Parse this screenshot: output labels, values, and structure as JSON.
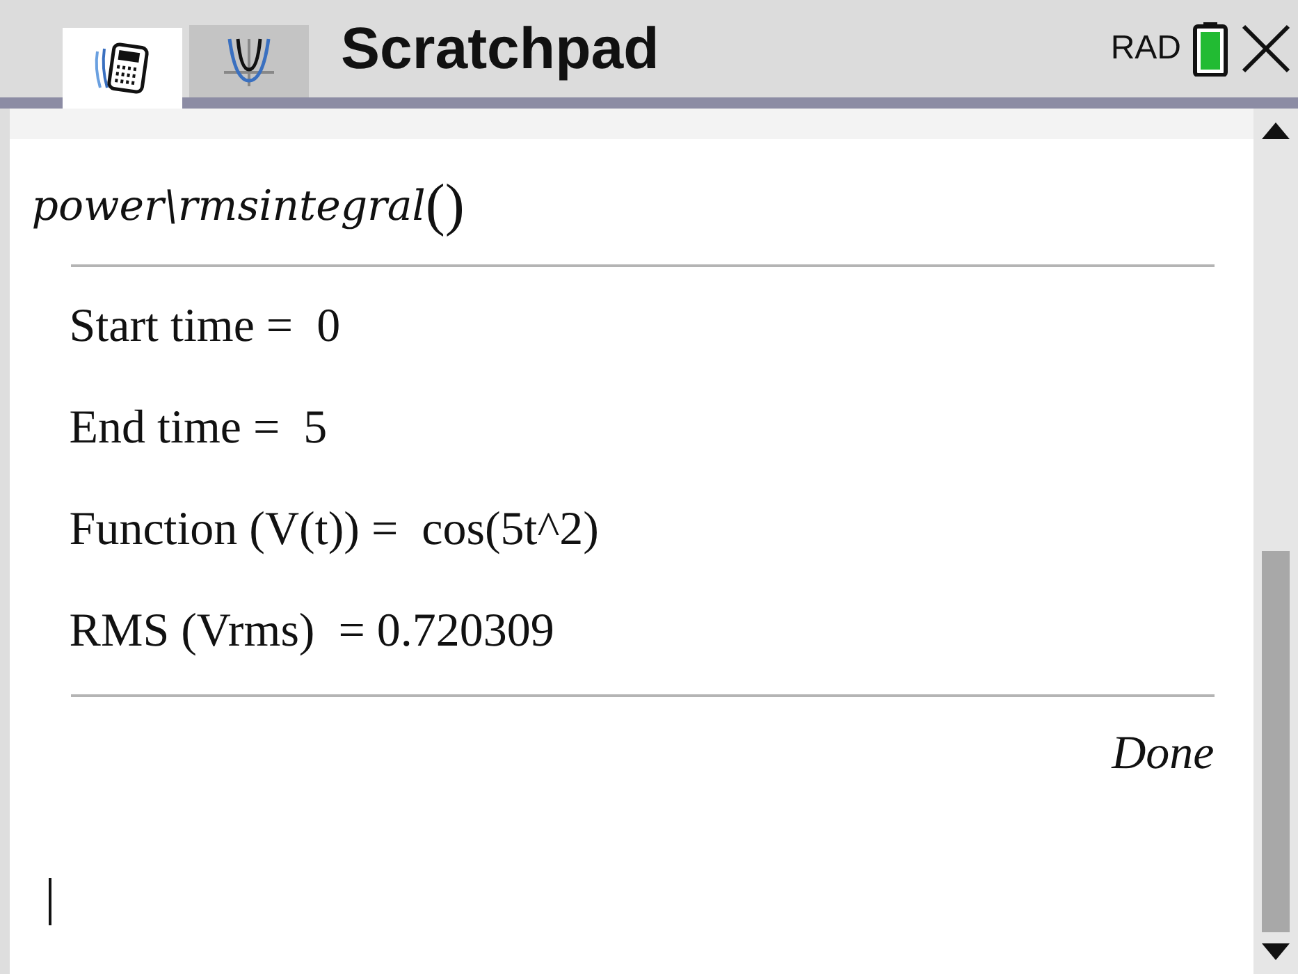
{
  "header": {
    "tabs": [
      {
        "kind": "calculator",
        "selected": true
      },
      {
        "kind": "graph",
        "selected": false
      }
    ],
    "title": "Scratchpad",
    "angle_mode": "RAD"
  },
  "history": {
    "command": "power\\rmsintegral",
    "parens": "()",
    "output_lines": [
      "Start time =  0",
      "End time =  5",
      "Function (V(t)) =  cos(5t^2)",
      "RMS (Vrms)  = 0.720309"
    ],
    "result": "Done"
  }
}
